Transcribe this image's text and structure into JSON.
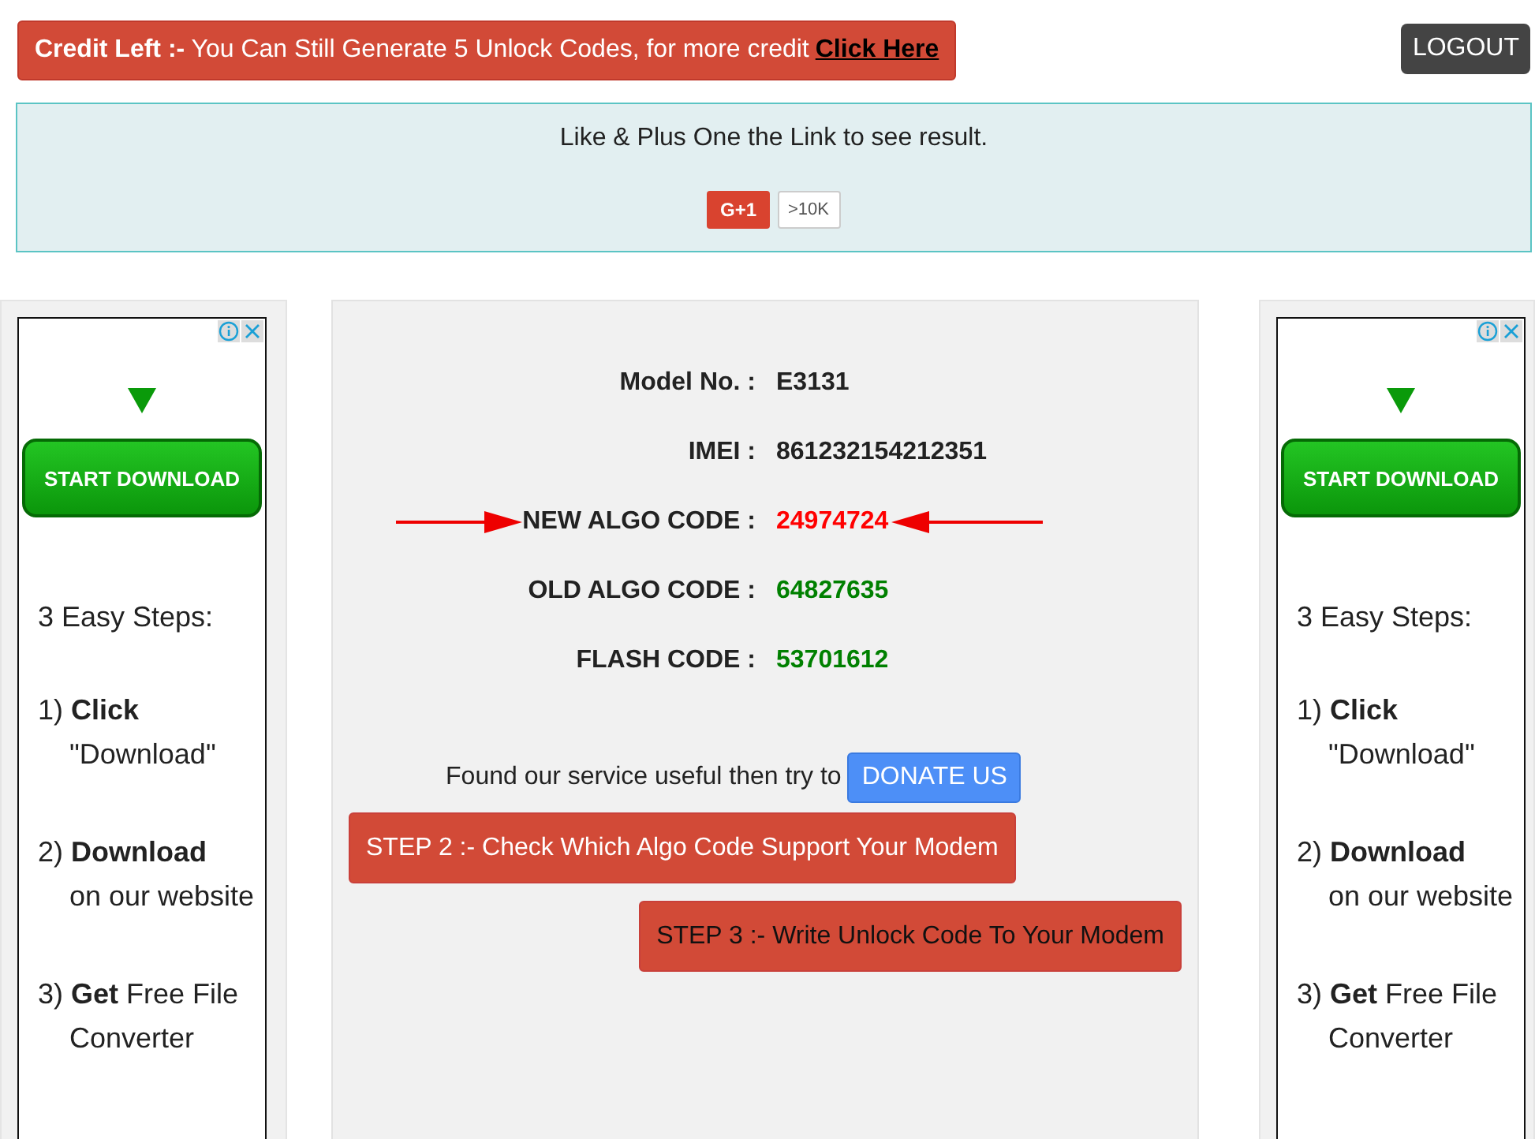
{
  "credit_banner": {
    "text": "**Credit Left :-** You Can Still Generate 5 Unlock Codes, for more credit",
    "link": "Click Here"
  },
  "logout_button": "LOGOUT",
  "like_box": {
    "message": "Like & Plus One the Link to see result.",
    "plus_one": "G+1",
    "count": ">10K"
  },
  "ads": [
    {
      "button": "START DOWNLOAD",
      "heading": "3 Easy Steps:",
      "steps": [
        {
          "lines": [
            "1) **Click**",
            "\"Download\""
          ]
        },
        {
          "lines": [
            "2) **Download**",
            "on our website"
          ]
        },
        {
          "lines": [
            "3) **Get** Free File",
            "Converter"
          ]
        }
      ]
    },
    {
      "button": "START DOWNLOAD",
      "heading": "3 Easy Steps:",
      "steps": [
        {
          "lines": [
            "1) **Click**",
            "\"Download\""
          ]
        },
        {
          "lines": [
            "2) **Download**",
            "on our website"
          ]
        },
        {
          "lines": [
            "3) **Get** Free File",
            "Converter"
          ]
        }
      ]
    }
  ],
  "result": {
    "rows": [
      {
        "label": "Model No. :",
        "value": "E3131",
        "color": "#222222",
        "arrows": false
      },
      {
        "label": "IMEI :",
        "value": "861232154212351",
        "color": "#222222",
        "arrows": false
      },
      {
        "label": "NEW ALGO CODE :",
        "value": "24974724",
        "color": "#ff0000",
        "arrows": true
      },
      {
        "label": "OLD ALGO CODE :",
        "value": "64827635",
        "color": "#008000",
        "arrows": false
      },
      {
        "label": "FLASH CODE :",
        "value": "53701612",
        "color": "#008000",
        "arrows": false
      }
    ],
    "donate_text": "Found our service useful then try to",
    "donate_button": "DONATE US",
    "steps": [
      {
        "text": "STEP 2 :- Check Which Algo Code Support Your Modem",
        "kind": "light"
      },
      {
        "text": "STEP 3 :- Write Unlock Code To Your Modem",
        "kind": "dark"
      }
    ]
  }
}
